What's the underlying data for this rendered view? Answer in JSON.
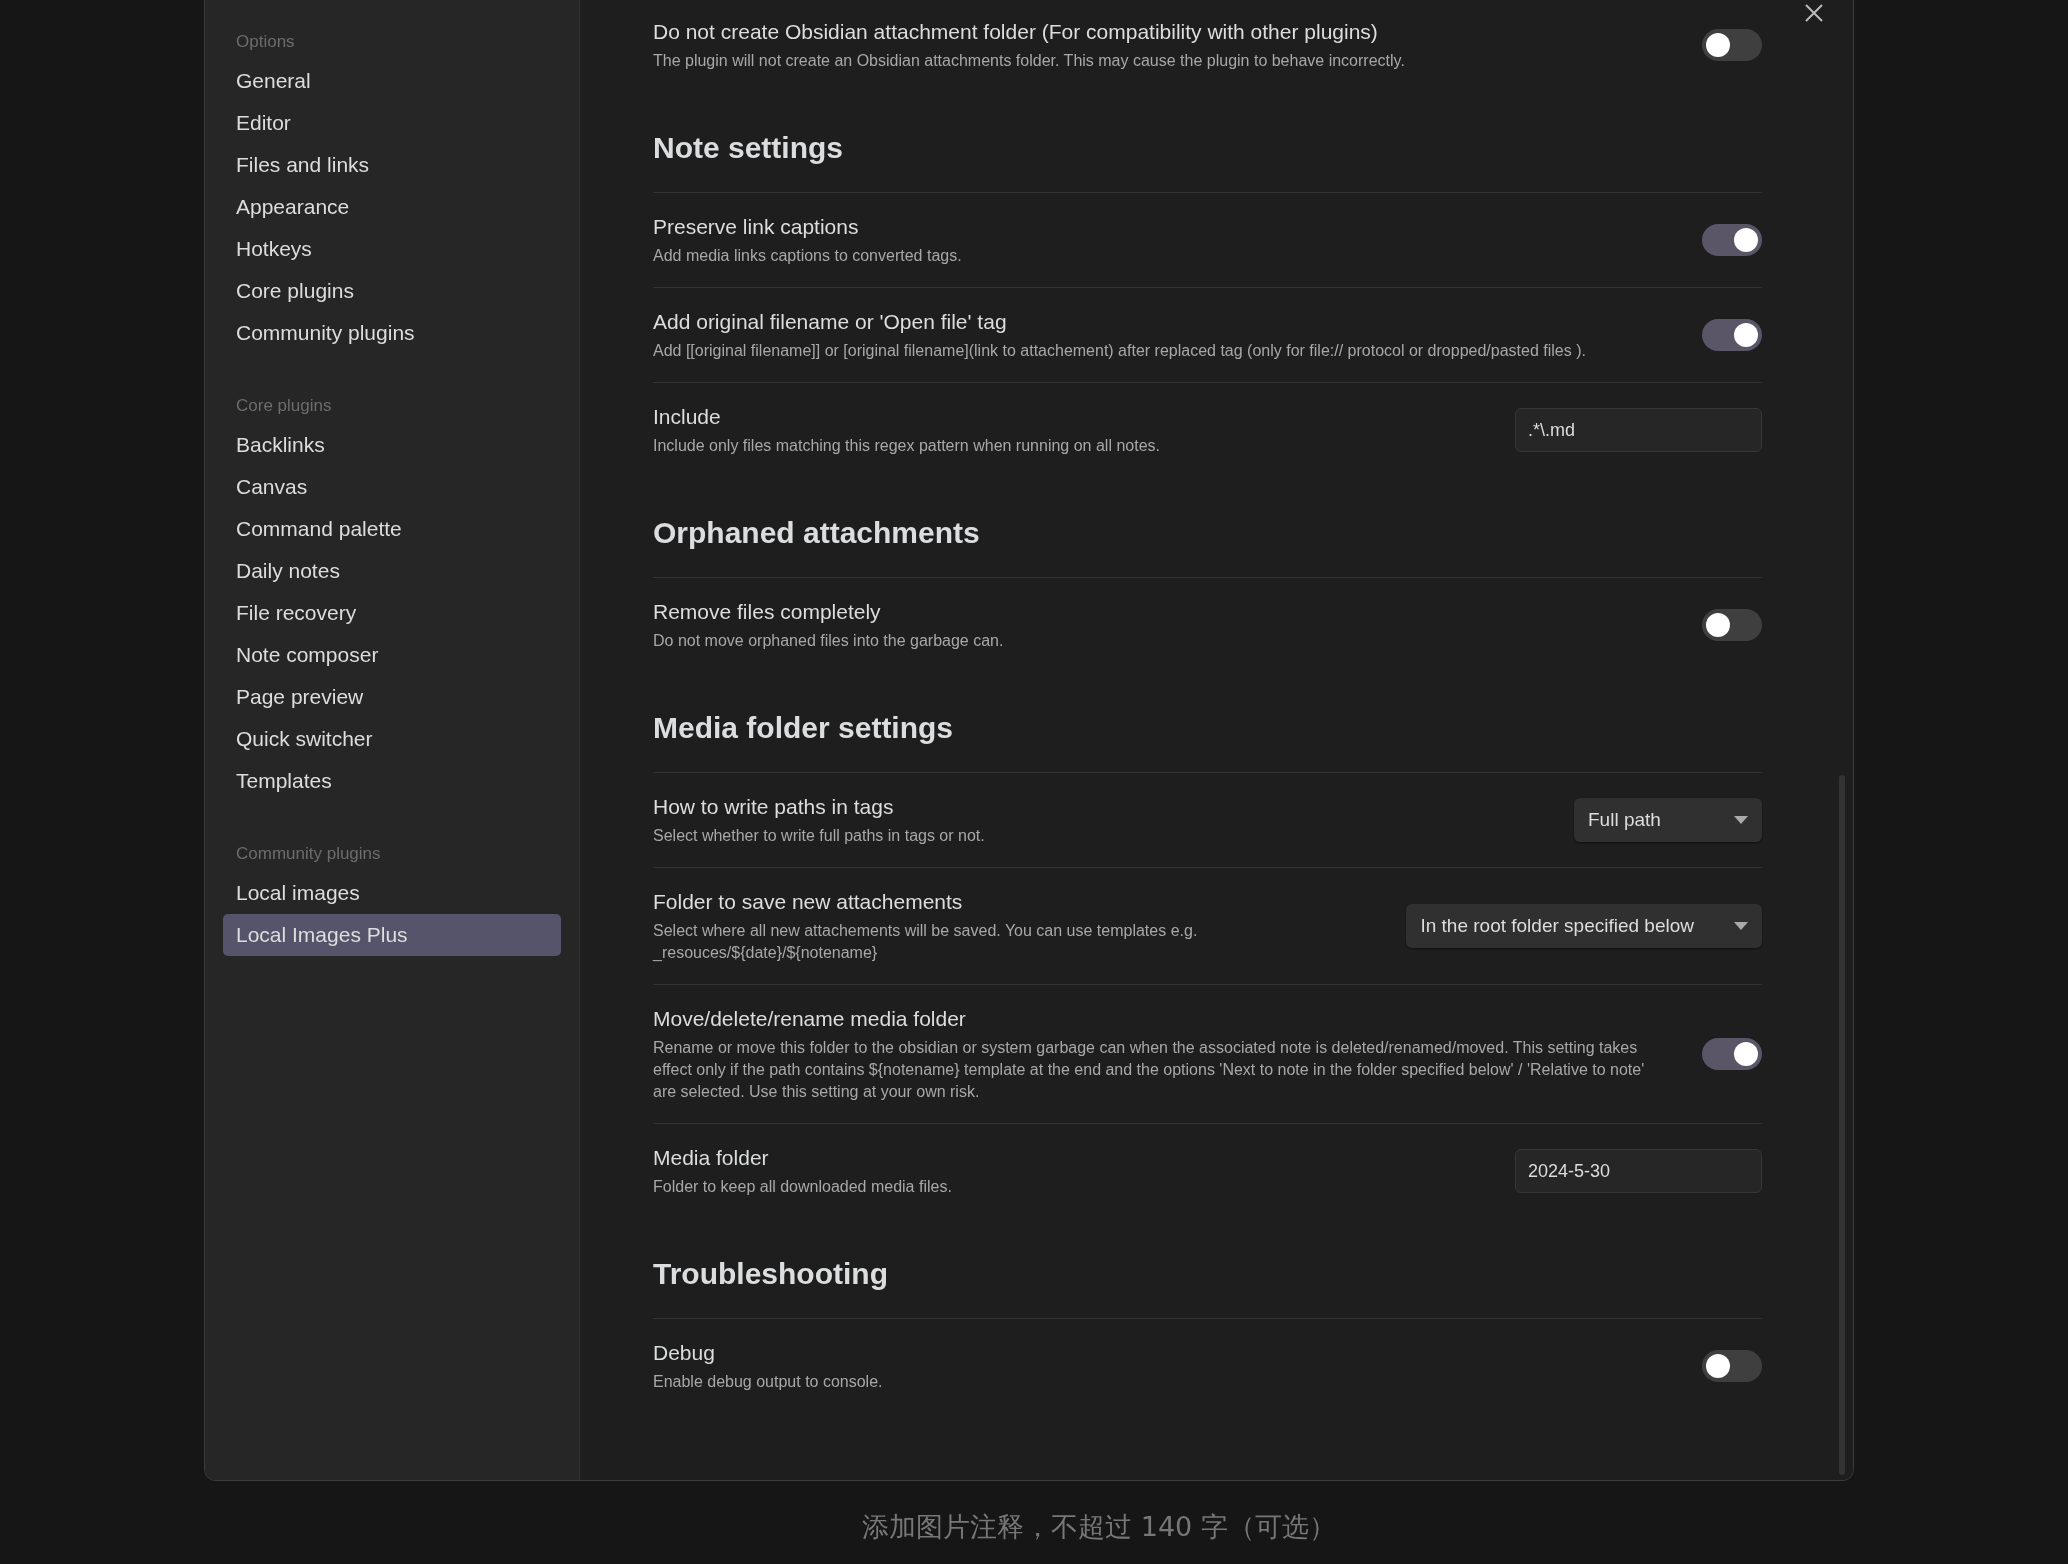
{
  "sidebar": {
    "groups": [
      {
        "label": "Options",
        "items": [
          {
            "label": "General",
            "selected": false
          },
          {
            "label": "Editor",
            "selected": false
          },
          {
            "label": "Files and links",
            "selected": false
          },
          {
            "label": "Appearance",
            "selected": false
          },
          {
            "label": "Hotkeys",
            "selected": false
          },
          {
            "label": "Core plugins",
            "selected": false
          },
          {
            "label": "Community plugins",
            "selected": false
          }
        ]
      },
      {
        "label": "Core plugins",
        "items": [
          {
            "label": "Backlinks",
            "selected": false
          },
          {
            "label": "Canvas",
            "selected": false
          },
          {
            "label": "Command palette",
            "selected": false
          },
          {
            "label": "Daily notes",
            "selected": false
          },
          {
            "label": "File recovery",
            "selected": false
          },
          {
            "label": "Note composer",
            "selected": false
          },
          {
            "label": "Page preview",
            "selected": false
          },
          {
            "label": "Quick switcher",
            "selected": false
          },
          {
            "label": "Templates",
            "selected": false
          }
        ]
      },
      {
        "label": "Community plugins",
        "items": [
          {
            "label": "Local images",
            "selected": false
          },
          {
            "label": "Local Images Plus",
            "selected": true
          }
        ]
      }
    ]
  },
  "settings": [
    {
      "kind": "setting",
      "name": "Do not create Obsidian attachment folder (For compatibility with other plugins)",
      "description": "The plugin will not create an Obsidian attachments folder. This may cause the plugin to behave incorrectly.",
      "control": {
        "kind": "toggle",
        "on": false
      }
    },
    {
      "kind": "heading",
      "name": "Note settings"
    },
    {
      "kind": "setting",
      "name": "Preserve link captions",
      "description": "Add media links captions to converted tags.",
      "control": {
        "kind": "toggle",
        "on": true
      }
    },
    {
      "kind": "setting",
      "name": "Add original filename or 'Open file' tag",
      "description": "Add [[original filename]] or [original filename](link to attachement) after replaced tag (only for file:// protocol or dropped/pasted files ).",
      "control": {
        "kind": "toggle",
        "on": true
      }
    },
    {
      "kind": "setting",
      "name": "Include",
      "description": "Include only files matching this regex pattern when running on all notes.",
      "control": {
        "kind": "text",
        "value": ".*\\.md"
      }
    },
    {
      "kind": "heading",
      "name": "Orphaned attachments"
    },
    {
      "kind": "setting",
      "name": "Remove files completely",
      "description": "Do not move orphaned files into the garbage can.",
      "control": {
        "kind": "toggle",
        "on": false
      }
    },
    {
      "kind": "heading",
      "name": "Media folder settings"
    },
    {
      "kind": "setting",
      "name": "How to write paths in tags",
      "description": "Select whether to write full paths in tags or not.",
      "control": {
        "kind": "dropdown",
        "value": "Full path"
      }
    },
    {
      "kind": "setting",
      "name": "Folder to save new attachements",
      "description": "Select where all new attachements will be saved. You can use templates e.g. _resouces/${date}/${notename}",
      "control": {
        "kind": "dropdown",
        "value": "In the root folder specified below"
      }
    },
    {
      "kind": "setting",
      "name": "Move/delete/rename media folder",
      "description": "Rename or move this folder to the obsidian or system garbage can when the associated note is deleted/renamed/moved. This setting takes effect only if the path contains ${notename} template at the end and the options 'Next to note in the folder specified below' / 'Relative to note' are selected. Use this setting at your own risk.",
      "control": {
        "kind": "toggle",
        "on": true
      }
    },
    {
      "kind": "setting",
      "name": "Media folder",
      "description": "Folder to keep all downloaded media files.",
      "control": {
        "kind": "text",
        "value": "2024-5-30"
      }
    },
    {
      "kind": "heading",
      "name": "Troubleshooting"
    },
    {
      "kind": "setting",
      "name": "Debug",
      "description": "Enable debug output to console.",
      "control": {
        "kind": "toggle",
        "on": false
      }
    }
  ],
  "caption": {
    "placeholder": "添加图片注释，不超过 140 字（可选）"
  }
}
